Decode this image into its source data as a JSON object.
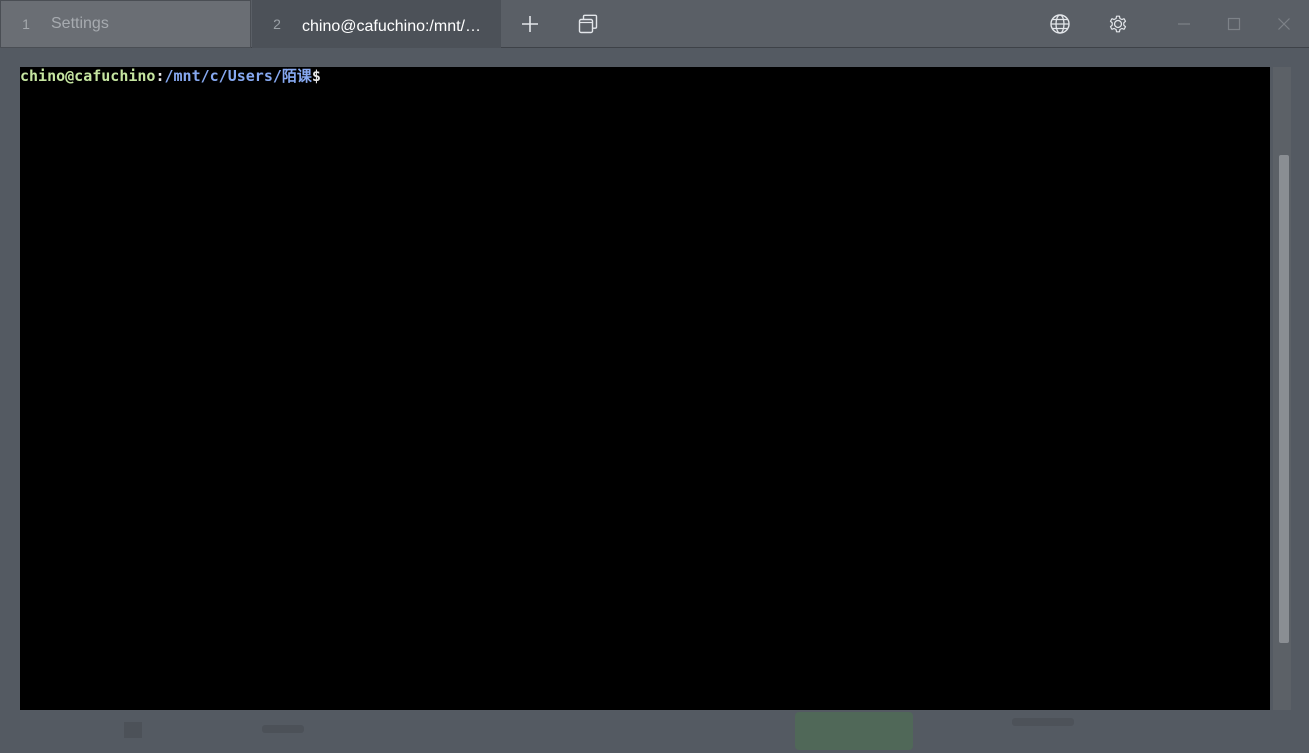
{
  "tabs": [
    {
      "number": "1",
      "title": "Settings",
      "active": false
    },
    {
      "number": "2",
      "title": "chino@cafuchino:/mnt/c/Users/陌课",
      "active": true
    }
  ],
  "titlebar": {
    "new_tab_icon": "plus-icon",
    "tab_switcher_icon": "stacked-windows-icon",
    "language_icon": "globe-icon",
    "settings_icon": "gear-icon",
    "minimize_icon": "minimize-icon",
    "maximize_icon": "maximize-icon",
    "close_icon": "close-icon"
  },
  "terminal": {
    "user_host": "chino@cafuchino",
    "colon": ":",
    "path": "/mnt/c/Users/陌课",
    "dollar": "$"
  },
  "colors": {
    "prompt_user": "#c5e5a0",
    "prompt_path": "#86a8f0",
    "terminal_bg": "#000000",
    "chrome_bg": "#545a62"
  }
}
